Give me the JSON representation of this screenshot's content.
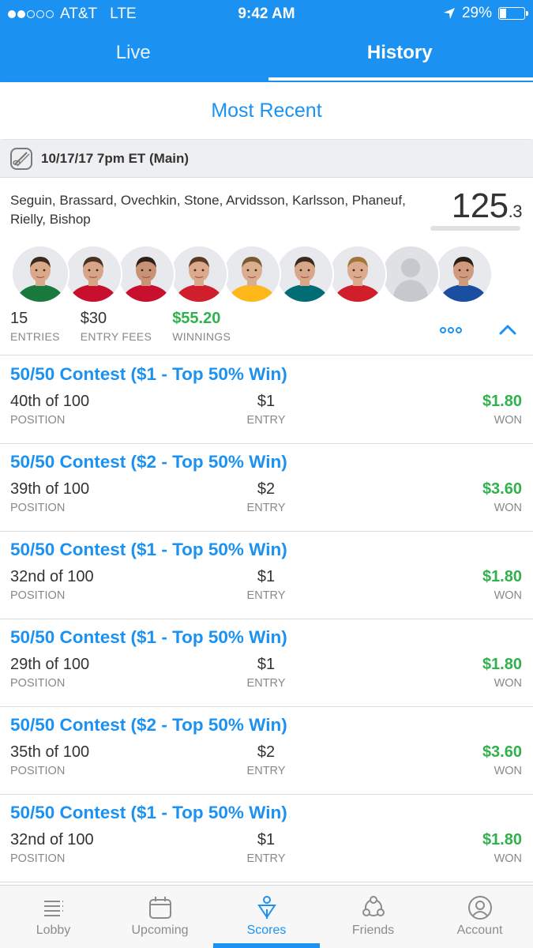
{
  "status_bar": {
    "carrier": "AT&T",
    "network": "LTE",
    "time": "9:42 AM",
    "battery_text": "29%",
    "battery_level": 0.29,
    "signal_bars_filled": 2,
    "signal_bars_total": 5
  },
  "tabs": [
    {
      "label": "Live",
      "active": false
    },
    {
      "label": "History",
      "active": true
    }
  ],
  "subheader": "Most Recent",
  "slate": {
    "label": "10/17/17 7pm ET (Main)",
    "icon": "hockey-puck-icon"
  },
  "lineup": {
    "players": "Seguin, Brassard, Ovechkin, Stone, Arvidsson, Karlsson, Phaneuf, Rielly, Bishop",
    "score_whole": "125",
    "score_decimal": ".3",
    "avatars": [
      {
        "jersey": "#1a7a3e",
        "skin": "#d9a98a",
        "hair": "#3b2a1e"
      },
      {
        "jersey": "#c8102e",
        "skin": "#d8a487",
        "hair": "#4a3222"
      },
      {
        "jersey": "#c8102e",
        "skin": "#c99274",
        "hair": "#2d2019"
      },
      {
        "jersey": "#d01e2b",
        "skin": "#dba98b",
        "hair": "#5a3a24"
      },
      {
        "jersey": "#ffb81c",
        "skin": "#dcae90",
        "hair": "#7a5a34"
      },
      {
        "jersey": "#006d75",
        "skin": "#d8a688",
        "hair": "#3a2a1e"
      },
      {
        "jersey": "#d01e2b",
        "skin": "#dcaa8d",
        "hair": "#a0763c"
      },
      {
        "jersey": "placeholder",
        "skin": "",
        "hair": ""
      },
      {
        "jersey": "#1a4ea0",
        "skin": "#d09a7c",
        "hair": "#2a1e16"
      }
    ],
    "stats": [
      {
        "value": "15",
        "label": "ENTRIES",
        "highlight": false
      },
      {
        "value": "$30",
        "label": "ENTRY FEES",
        "highlight": false
      },
      {
        "value": "$55.20",
        "label": "WINNINGS",
        "highlight": true
      }
    ],
    "more_icon": "more-dots-icon",
    "collapse_icon": "chevron-up-icon"
  },
  "contests": [
    {
      "title": "50/50 Contest ($1 - Top 50% Win)",
      "position": "40th of 100",
      "position_label": "POSITION",
      "entry": "$1",
      "entry_label": "ENTRY",
      "won": "$1.80",
      "won_label": "WON"
    },
    {
      "title": "50/50 Contest ($2 - Top 50% Win)",
      "position": "39th of 100",
      "position_label": "POSITION",
      "entry": "$2",
      "entry_label": "ENTRY",
      "won": "$3.60",
      "won_label": "WON"
    },
    {
      "title": "50/50 Contest ($1 - Top 50% Win)",
      "position": "32nd of 100",
      "position_label": "POSITION",
      "entry": "$1",
      "entry_label": "ENTRY",
      "won": "$1.80",
      "won_label": "WON"
    },
    {
      "title": "50/50 Contest ($1 - Top 50% Win)",
      "position": "29th of 100",
      "position_label": "POSITION",
      "entry": "$1",
      "entry_label": "ENTRY",
      "won": "$1.80",
      "won_label": "WON"
    },
    {
      "title": "50/50 Contest ($2 - Top 50% Win)",
      "position": "35th of 100",
      "position_label": "POSITION",
      "entry": "$2",
      "entry_label": "ENTRY",
      "won": "$3.60",
      "won_label": "WON"
    },
    {
      "title": "50/50 Contest ($1 - Top 50% Win)",
      "position": "32nd of 100",
      "position_label": "POSITION",
      "entry": "$1",
      "entry_label": "ENTRY",
      "won": "$1.80",
      "won_label": "WON"
    }
  ],
  "bottom_nav": [
    {
      "label": "Lobby",
      "icon": "lobby-list-icon",
      "active": false
    },
    {
      "label": "Upcoming",
      "icon": "calendar-icon",
      "active": false
    },
    {
      "label": "Scores",
      "icon": "scores-person-icon",
      "active": true
    },
    {
      "label": "Friends",
      "icon": "friends-icon",
      "active": false
    },
    {
      "label": "Account",
      "icon": "account-icon",
      "active": false
    }
  ],
  "colors": {
    "brand_blue": "#1b92f1",
    "win_green": "#2fb24c",
    "muted_gray": "#888888"
  }
}
